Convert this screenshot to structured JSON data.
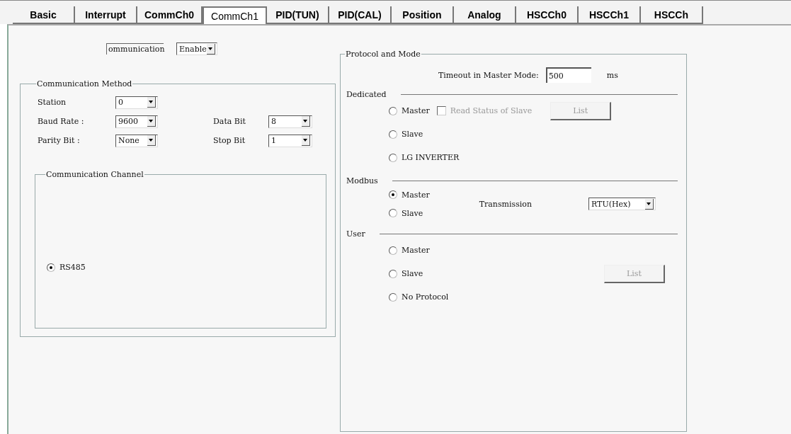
{
  "tabs": [
    {
      "label": "Basic",
      "selected": false
    },
    {
      "label": "Interrupt",
      "selected": false
    },
    {
      "label": "CommCh0",
      "selected": false
    },
    {
      "label": "CommCh1",
      "selected": true
    },
    {
      "label": "PID(TUN)",
      "selected": false
    },
    {
      "label": "PID(CAL)",
      "selected": false
    },
    {
      "label": "Position",
      "selected": false
    },
    {
      "label": "Analog",
      "selected": false
    },
    {
      "label": "HSCCh0",
      "selected": false
    },
    {
      "label": "HSCCh1",
      "selected": false
    },
    {
      "label": "HSCCh",
      "selected": false
    }
  ],
  "communication": {
    "label": "ommunication",
    "value": "Enable"
  },
  "method": {
    "title": "Communication Method",
    "rows": [
      [
        {
          "label": "Station",
          "value": "0"
        }
      ],
      [
        {
          "label": "Baud Rate :",
          "value": "9600"
        },
        {
          "label": "Data Bit",
          "value": "8"
        }
      ],
      [
        {
          "label": "Parity Bit :",
          "value": "None"
        },
        {
          "label": "Stop Bit",
          "value": "1"
        }
      ]
    ],
    "channel": {
      "title": "Communication Channel",
      "options": [
        {
          "label": "RS485",
          "selected": true
        }
      ]
    }
  },
  "protocol": {
    "title": "Protocol and Mode",
    "timeout": {
      "label": "Timeout in Master Mode:",
      "value": "500",
      "unit": "ms"
    },
    "sections": [
      {
        "title": "Dedicated",
        "options": [
          {
            "label": "Master",
            "selected": false,
            "checkbox": {
              "label": "Read Status of Slave",
              "checked": false,
              "disabled": true
            },
            "button": {
              "label": "List",
              "disabled": true
            }
          },
          {
            "label": "Slave",
            "selected": false
          },
          {
            "label": "LG INVERTER",
            "selected": false
          }
        ]
      },
      {
        "title": "Modbus",
        "options": [
          {
            "label": "Master",
            "selected": true
          },
          {
            "label": "Slave",
            "selected": false
          }
        ],
        "transmission": {
          "label": "Transmission",
          "value": "RTU(Hex)"
        }
      },
      {
        "title": "User",
        "options": [
          {
            "label": "Master",
            "selected": false
          },
          {
            "label": "Slave",
            "selected": false
          },
          {
            "label": "No Protocol",
            "selected": false
          }
        ],
        "button": {
          "label": "List",
          "disabled": true
        }
      }
    ]
  }
}
